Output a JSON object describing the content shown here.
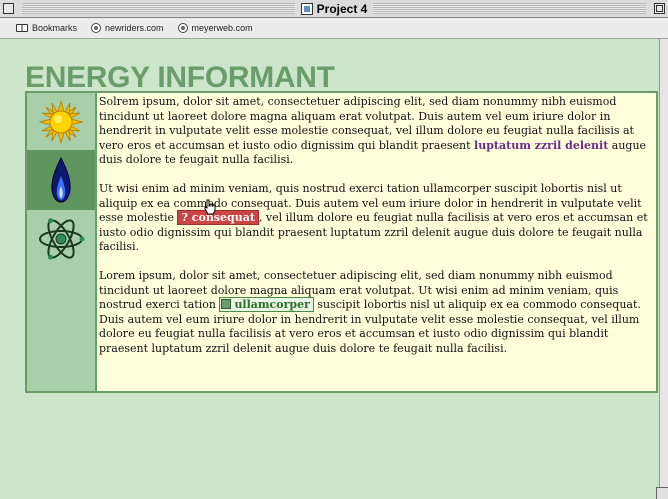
{
  "window": {
    "title": "Project 4"
  },
  "bookmarks_bar": {
    "items": [
      {
        "label": "Bookmarks",
        "icon": "book-icon"
      },
      {
        "label": "newriders.com",
        "icon": "globe-icon"
      },
      {
        "label": "meyerweb.com",
        "icon": "globe-icon"
      }
    ]
  },
  "page": {
    "heading": "ENERGY INFORMANT",
    "colors": {
      "background": "#cce6cc",
      "accent": "#6a9d6a",
      "content_bg": "#ffffdc",
      "link": "#6b2c8a",
      "badge_red": "#cc4444"
    },
    "icons": [
      "sun-icon",
      "flame-icon",
      "atom-icon"
    ],
    "paragraph1": {
      "before": "Solrem ipsum, dolor sit amet, consectetuer adipiscing elit, sed diam nonummy nibh euismod tincidunt ut laoreet dolore magna aliquam erat volutpat. Duis autem vel eum iriure dolor in hendrerit in vulputate velit esse molestie consequat, vel illum dolore eu feugiat nulla facilisis at vero eros et accumsan et iusto odio dignissim qui blandit praesent ",
      "link": "luptatum zzril delenit",
      "after": " augue duis dolore te feugait nulla facilisi."
    },
    "paragraph2": {
      "before": "Ut wisi enim ad minim veniam, quis nostrud exerci tation ullamcorper suscipit lobortis nisl ut aliquip ex ea commodo consequat. Duis autem vel eum iriure dolor in hendrerit in vulputate velit esse molestie ",
      "badge_mark": "?",
      "badge": "consequat",
      "after": ", vel illum dolore eu feugiat nulla facilisis at vero eros et accumsan et iusto odio dignissim qui blandit praesent luptatum zzril delenit augue duis dolore te feugait nulla facilisi."
    },
    "paragraph3": {
      "before": "Lorem ipsum, dolor sit amet, consectetuer adipiscing elit, sed diam nonummy nibh euismod tincidunt ut laoreet dolore magna aliquam erat volutpat. Ut wisi enim ad minim veniam, quis nostrud exerci tation ",
      "badge": "ullamcorper",
      "after": " suscipit lobortis nisl ut aliquip ex ea commodo consequat. Duis autem vel eum iriure dolor in hendrerit in vulputate velit esse molestie consequat, vel illum dolore eu feugiat nulla facilisis at vero eros et accumsan et iusto odio dignissim qui blandit praesent luptatum zzril delenit augue duis dolore te feugait nulla facilisi."
    }
  }
}
